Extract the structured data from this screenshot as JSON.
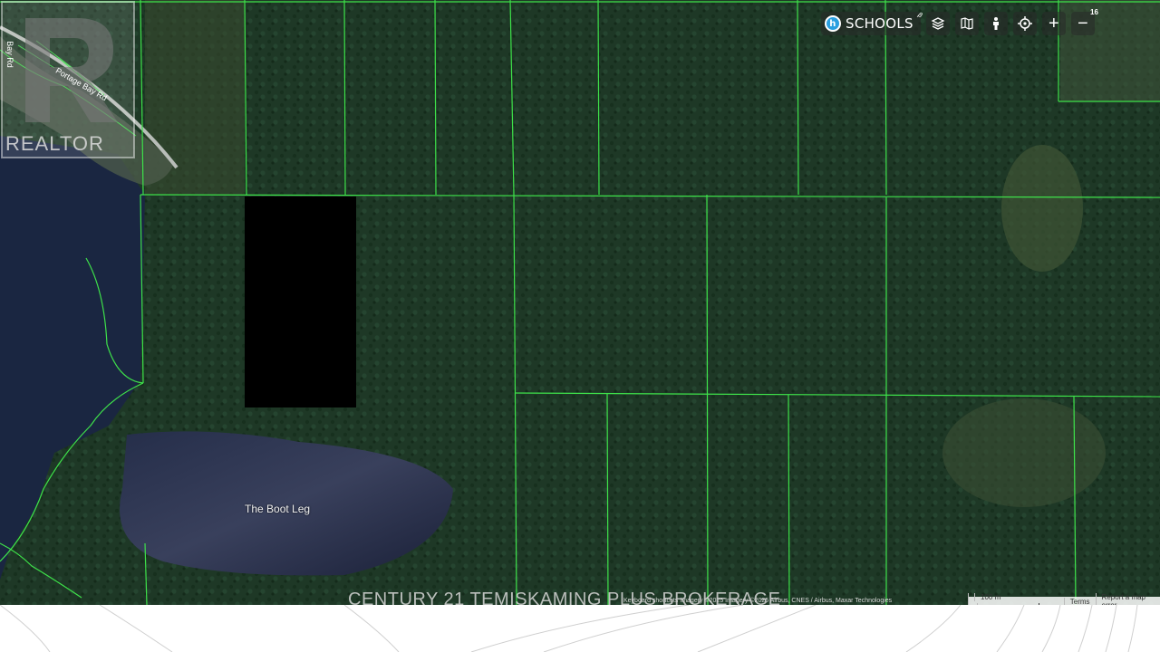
{
  "map": {
    "road_labels": [
      "Portage Bay Rd",
      "Bay Rd"
    ],
    "lake_label": "The Boot Leg",
    "watermark": "REALTOR",
    "zoom_level": "16",
    "colors": {
      "parcel_lines": "#3ee24a",
      "water": "#1d2a45",
      "forest": "#1f3a27"
    }
  },
  "toolbar": {
    "schools_label": "SCHOOLS",
    "schools_icon_letter": "h",
    "layers_icon": "layers-icon",
    "map_icon": "map-icon",
    "streetview_icon": "pegman-icon",
    "locate_icon": "crosshair-icon",
    "zoom_in_label": "+",
    "zoom_out_label": "−"
  },
  "attribution": {
    "left": "Keyboard shortcuts  Imagery ©2025 Imagery ©2025 Airbus, CNES / Airbus, Maxar Technologies",
    "scale": "100 m",
    "terms": "Terms",
    "report": "Report a map error"
  },
  "brokerage": "CENTURY 21 TEMISKAMING PLUS BROKERAGE"
}
